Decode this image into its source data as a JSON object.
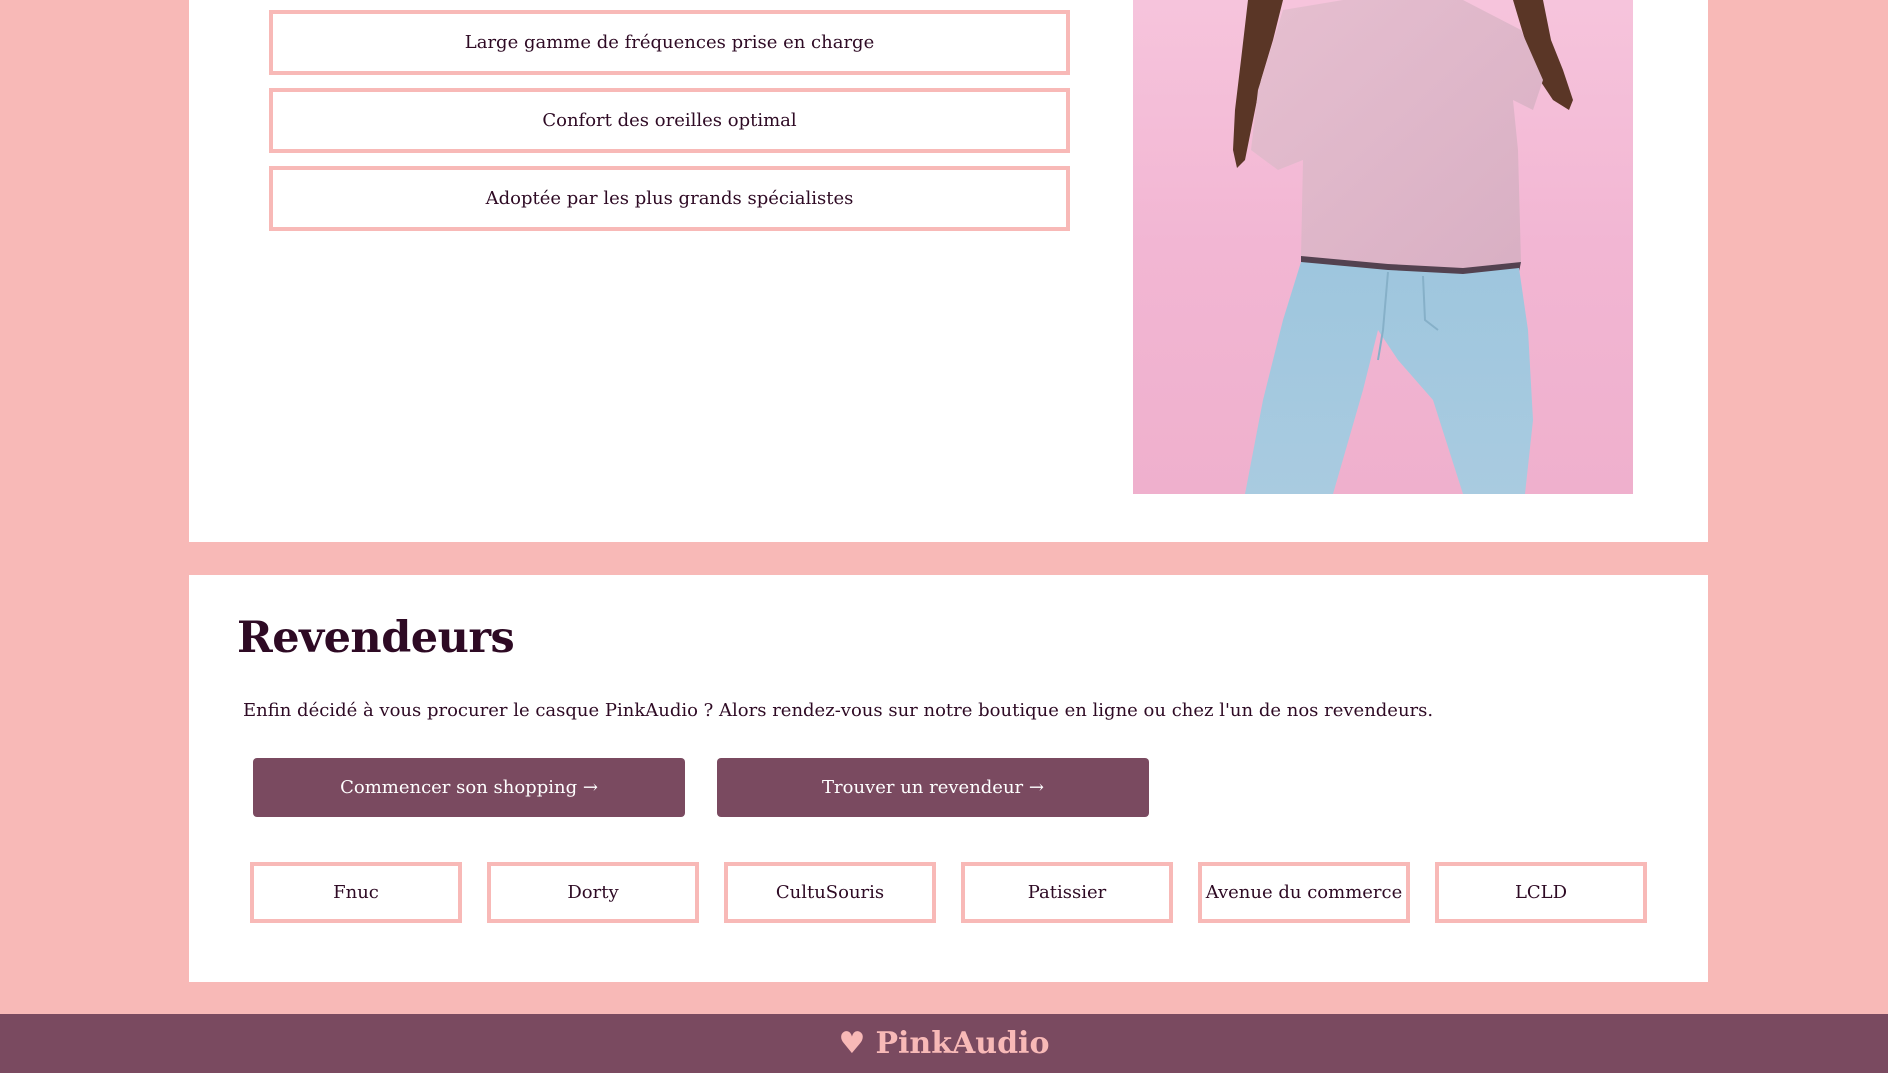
{
  "features": [
    "Large gamme de fréquences prise en charge",
    "Confort des oreilles optimal",
    "Adoptée par les plus grands spécialistes"
  ],
  "resellers": {
    "title": "Revendeurs",
    "text": "Enfin décidé à vous procurer le casque PinkAudio ? Alors rendez-vous sur notre boutique en ligne ou chez l'un de nos revendeurs.",
    "shop_label": "Commencer son shopping →",
    "find_label": "Trouver un revendeur →",
    "shops": [
      "Fnuc",
      "Dorty",
      "CultuSouris",
      "Patissier",
      "Avenue du commerce",
      "LCLD"
    ]
  },
  "footer": {
    "heart": "♥",
    "brand": "PinkAudio"
  },
  "colors": {
    "background": "#f8b9b7",
    "accent": "#7a4a60",
    "text": "#2e0a24"
  }
}
